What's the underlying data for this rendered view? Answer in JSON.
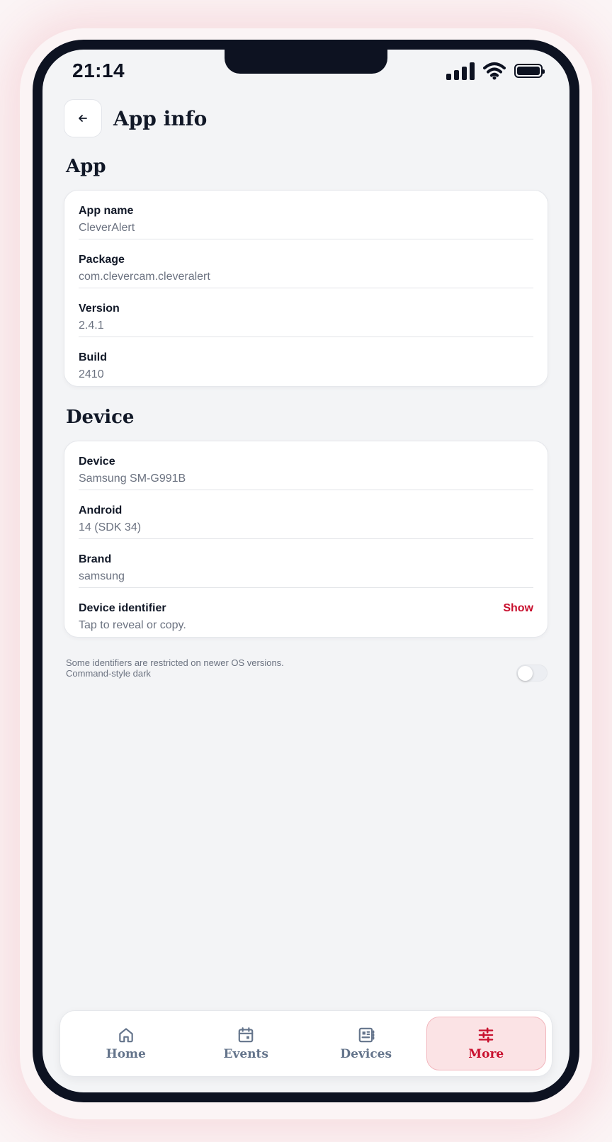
{
  "status_bar": {
    "time": "21:14"
  },
  "header": {
    "title": "App info"
  },
  "sections": [
    {
      "title": "App",
      "rows": [
        {
          "label": "App name",
          "value": "CleverAlert"
        },
        {
          "label": "Package",
          "value": "com.clevercam.cleveralert"
        },
        {
          "label": "Version",
          "value": "2.4.1"
        },
        {
          "label": "Build",
          "value": "2410"
        }
      ]
    },
    {
      "title": "Device",
      "rows": [
        {
          "label": "Device",
          "value": "Samsung SM-G991B"
        },
        {
          "label": "Android",
          "value": "14 (SDK 34)"
        },
        {
          "label": "Brand",
          "value": "samsung"
        },
        {
          "label": "Device identifier",
          "value": "Tap to reveal or copy.",
          "action": "Show"
        }
      ]
    }
  ],
  "note": "Some identifiers are restricted on newer OS versions.",
  "toggle": {
    "label": "Command-style dark",
    "on": false
  },
  "tabbar": {
    "tabs": [
      {
        "label": "Home",
        "icon": "home-icon",
        "active": false
      },
      {
        "label": "Events",
        "icon": "calendar-icon",
        "active": false
      },
      {
        "label": "Devices",
        "icon": "devices-icon",
        "active": false
      },
      {
        "label": "More",
        "icon": "sliders-icon",
        "active": true
      }
    ]
  },
  "colors": {
    "accent": "#c8102e",
    "accent_bg": "#fbe3e5",
    "text": "#111827",
    "muted": "#6b7280"
  }
}
